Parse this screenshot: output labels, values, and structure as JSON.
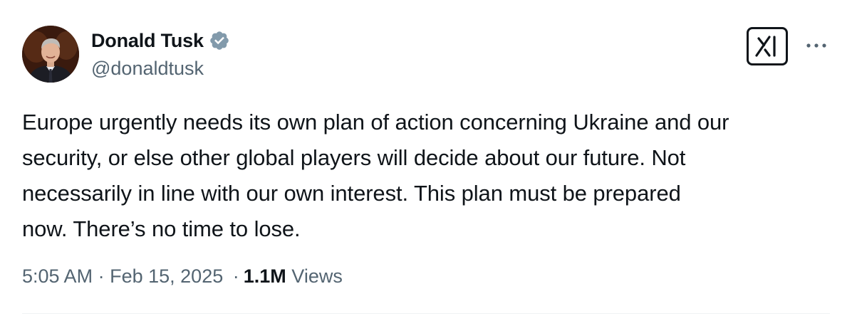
{
  "author": {
    "display_name": "Donald Tusk",
    "handle": "@donaldtusk",
    "verified": true,
    "verified_color": "#829aab"
  },
  "actions": {
    "grok_icon": "grok-logo-icon",
    "more_icon": "more-horizontal-icon"
  },
  "tweet": {
    "lines": [
      "Europe urgently needs its own plan of action concerning Ukraine and our",
      "security, or else other global players will decide about our future. Not",
      "necessarily in line with our own interest. This plan must be prepared",
      "now. There’s no time to lose."
    ]
  },
  "meta": {
    "time": "5:05 AM",
    "separator": "·",
    "date": "Feb 15, 2025",
    "views_count": "1.1M",
    "views_label": "Views"
  },
  "colors": {
    "text_primary": "#0f1419",
    "text_secondary": "#536471",
    "divider": "#eff3f4"
  }
}
